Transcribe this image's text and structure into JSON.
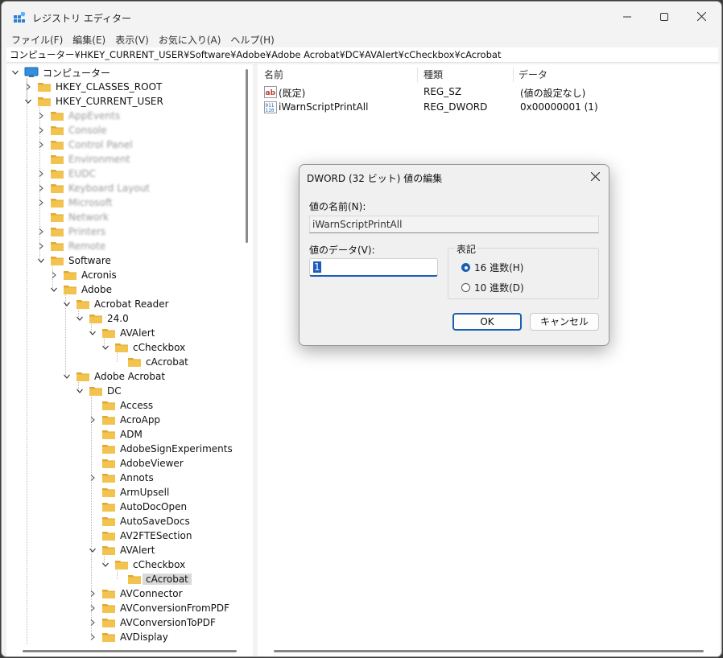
{
  "window": {
    "title": "レジストリ エディター",
    "controls": {
      "minimize_icon": "minimize-icon",
      "maximize_icon": "maximize-icon",
      "close_icon": "close-icon"
    }
  },
  "menu": [
    "ファイル(F)",
    "編集(E)",
    "表示(V)",
    "お気に入り(A)",
    "ヘルプ(H)"
  ],
  "address": "コンピューター¥HKEY_CURRENT_USER¥Software¥Adobe¥Adobe Acrobat¥DC¥AVAlert¥cCheckbox¥cAcrobat",
  "tree": [
    {
      "label": "コンピューター",
      "depth": 0,
      "state": "expanded",
      "icon": "computer",
      "blur": false,
      "selected": false
    },
    {
      "label": "HKEY_CLASSES_ROOT",
      "depth": 1,
      "state": "collapsed",
      "icon": "folder",
      "blur": false,
      "selected": false
    },
    {
      "label": "HKEY_CURRENT_USER",
      "depth": 1,
      "state": "expanded",
      "icon": "folder",
      "blur": false,
      "selected": false
    },
    {
      "label": "AppEvents",
      "depth": 2,
      "state": "collapsed",
      "icon": "folder",
      "blur": true,
      "selected": false
    },
    {
      "label": "Console",
      "depth": 2,
      "state": "collapsed",
      "icon": "folder",
      "blur": true,
      "selected": false
    },
    {
      "label": "Control Panel",
      "depth": 2,
      "state": "collapsed",
      "icon": "folder",
      "blur": true,
      "selected": false
    },
    {
      "label": "Environment",
      "depth": 2,
      "state": "none",
      "icon": "folder",
      "blur": true,
      "selected": false
    },
    {
      "label": "EUDC",
      "depth": 2,
      "state": "collapsed",
      "icon": "folder",
      "blur": true,
      "selected": false
    },
    {
      "label": "Keyboard Layout",
      "depth": 2,
      "state": "collapsed",
      "icon": "folder",
      "blur": true,
      "selected": false
    },
    {
      "label": "Microsoft",
      "depth": 2,
      "state": "collapsed",
      "icon": "folder",
      "blur": true,
      "selected": false
    },
    {
      "label": "Network",
      "depth": 2,
      "state": "none",
      "icon": "folder",
      "blur": true,
      "selected": false
    },
    {
      "label": "Printers",
      "depth": 2,
      "state": "collapsed",
      "icon": "folder",
      "blur": true,
      "selected": false
    },
    {
      "label": "Remote",
      "depth": 2,
      "state": "collapsed",
      "icon": "folder",
      "blur": true,
      "selected": false
    },
    {
      "label": "Software",
      "depth": 2,
      "state": "expanded",
      "icon": "folder",
      "blur": false,
      "selected": false
    },
    {
      "label": "Acronis",
      "depth": 3,
      "state": "collapsed",
      "icon": "folder",
      "blur": false,
      "selected": false
    },
    {
      "label": "Adobe",
      "depth": 3,
      "state": "expanded",
      "icon": "folder",
      "blur": false,
      "selected": false
    },
    {
      "label": "Acrobat Reader",
      "depth": 4,
      "state": "expanded",
      "icon": "folder",
      "blur": false,
      "selected": false
    },
    {
      "label": "24.0",
      "depth": 5,
      "state": "expanded",
      "icon": "folder",
      "blur": false,
      "selected": false
    },
    {
      "label": "AVAlert",
      "depth": 6,
      "state": "expanded",
      "icon": "folder",
      "blur": false,
      "selected": false
    },
    {
      "label": "cCheckbox",
      "depth": 7,
      "state": "expanded",
      "icon": "folder",
      "blur": false,
      "selected": false
    },
    {
      "label": "cAcrobat",
      "depth": 8,
      "state": "none",
      "icon": "folder",
      "blur": false,
      "selected": false
    },
    {
      "label": "Adobe Acrobat",
      "depth": 4,
      "state": "expanded",
      "icon": "folder",
      "blur": false,
      "selected": false
    },
    {
      "label": "DC",
      "depth": 5,
      "state": "expanded",
      "icon": "folder",
      "blur": false,
      "selected": false
    },
    {
      "label": "Access",
      "depth": 6,
      "state": "none",
      "icon": "folder",
      "blur": false,
      "selected": false
    },
    {
      "label": "AcroApp",
      "depth": 6,
      "state": "collapsed",
      "icon": "folder",
      "blur": false,
      "selected": false
    },
    {
      "label": "ADM",
      "depth": 6,
      "state": "none",
      "icon": "folder",
      "blur": false,
      "selected": false
    },
    {
      "label": "AdobeSignExperiments",
      "depth": 6,
      "state": "none",
      "icon": "folder",
      "blur": false,
      "selected": false
    },
    {
      "label": "AdobeViewer",
      "depth": 6,
      "state": "none",
      "icon": "folder",
      "blur": false,
      "selected": false
    },
    {
      "label": "Annots",
      "depth": 6,
      "state": "collapsed",
      "icon": "folder",
      "blur": false,
      "selected": false
    },
    {
      "label": "ArmUpsell",
      "depth": 6,
      "state": "none",
      "icon": "folder",
      "blur": false,
      "selected": false
    },
    {
      "label": "AutoDocOpen",
      "depth": 6,
      "state": "none",
      "icon": "folder",
      "blur": false,
      "selected": false
    },
    {
      "label": "AutoSaveDocs",
      "depth": 6,
      "state": "none",
      "icon": "folder",
      "blur": false,
      "selected": false
    },
    {
      "label": "AV2FTESection",
      "depth": 6,
      "state": "none",
      "icon": "folder",
      "blur": false,
      "selected": false
    },
    {
      "label": "AVAlert",
      "depth": 6,
      "state": "expanded",
      "icon": "folder",
      "blur": false,
      "selected": false
    },
    {
      "label": "cCheckbox",
      "depth": 7,
      "state": "expanded",
      "icon": "folder",
      "blur": false,
      "selected": false
    },
    {
      "label": "cAcrobat",
      "depth": 8,
      "state": "none",
      "icon": "folder",
      "blur": false,
      "selected": true
    },
    {
      "label": "AVConnector",
      "depth": 6,
      "state": "collapsed",
      "icon": "folder",
      "blur": false,
      "selected": false
    },
    {
      "label": "AVConversionFromPDF",
      "depth": 6,
      "state": "collapsed",
      "icon": "folder",
      "blur": false,
      "selected": false
    },
    {
      "label": "AVConversionToPDF",
      "depth": 6,
      "state": "collapsed",
      "icon": "folder",
      "blur": false,
      "selected": false
    },
    {
      "label": "AVDisplay",
      "depth": 6,
      "state": "collapsed",
      "icon": "folder",
      "blur": false,
      "selected": false
    }
  ],
  "list": {
    "columns": [
      "名前",
      "種類",
      "データ"
    ],
    "rows": [
      {
        "icon": "string-value-icon",
        "name": "(既定)",
        "type": "REG_SZ",
        "data": "(値の設定なし)"
      },
      {
        "icon": "binary-value-icon",
        "name": "iWarnScriptPrintAll",
        "type": "REG_DWORD",
        "data": "0x00000001 (1)"
      }
    ]
  },
  "dialog": {
    "title": "DWORD (32 ビット) 値の編集",
    "name_label": "値の名前(N):",
    "name_value": "iWarnScriptPrintAll",
    "data_label": "値のデータ(V):",
    "data_value": "1",
    "base_label": "表記",
    "base_hex": "16 進数(H)",
    "base_dec": "10 進数(D)",
    "base_selected": "hex",
    "ok": "OK",
    "cancel": "キャンセル"
  },
  "colors": {
    "accent": "#1c5fb0",
    "folder": "#f3c34f",
    "folder_dark": "#e0a82e"
  }
}
